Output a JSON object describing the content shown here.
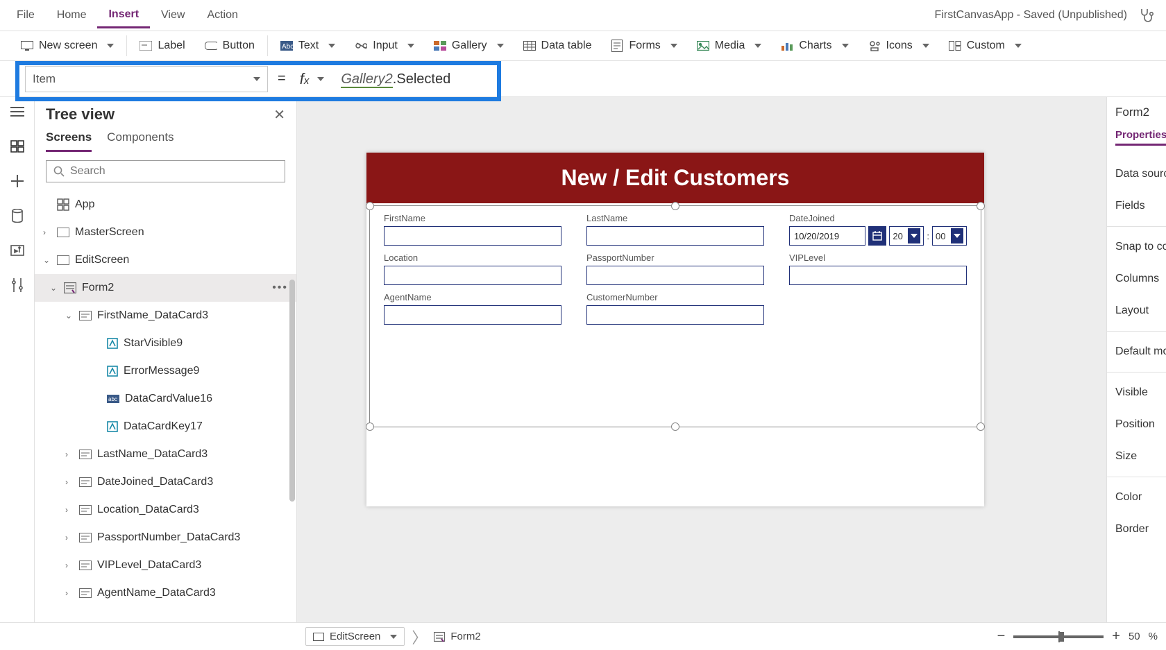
{
  "menu": {
    "items": [
      "File",
      "Home",
      "Insert",
      "View",
      "Action"
    ],
    "active": 2,
    "appTitle": "FirstCanvasApp - Saved (Unpublished)"
  },
  "ribbon": {
    "newScreen": "New screen",
    "label": "Label",
    "button": "Button",
    "text": "Text",
    "input": "Input",
    "gallery": "Gallery",
    "dataTable": "Data table",
    "forms": "Forms",
    "media": "Media",
    "charts": "Charts",
    "icons": "Icons",
    "custom": "Custom"
  },
  "formula": {
    "property": "Item",
    "gallRef": "Gallery2",
    "rest": ".Selected",
    "intelli": "Selected"
  },
  "tree": {
    "title": "Tree view",
    "tabs": [
      "Screens",
      "Components"
    ],
    "searchPlaceholder": "Search",
    "app": "App",
    "items": [
      {
        "name": "MasterScreen"
      },
      {
        "name": "EditScreen"
      }
    ],
    "form": "Form2",
    "card1": "FirstName_DataCard3",
    "children1": [
      "StarVisible9",
      "ErrorMessage9",
      "DataCardValue16",
      "DataCardKey17"
    ],
    "restCards": [
      "LastName_DataCard3",
      "DateJoined_DataCard3",
      "Location_DataCard3",
      "PassportNumber_DataCard3",
      "VIPLevel_DataCard3",
      "AgentName_DataCard3"
    ]
  },
  "canvas": {
    "header": "New / Edit Customers",
    "fields": {
      "firstName": "FirstName",
      "lastName": "LastName",
      "dateJoined": "DateJoined",
      "dateVal": "10/20/2019",
      "hour": "20",
      "min": "00",
      "location": "Location",
      "passport": "PassportNumber",
      "vip": "VIPLevel",
      "agent": "AgentName",
      "customerNo": "CustomerNumber"
    }
  },
  "properties": {
    "panelTitle": "Form2",
    "tab": "Properties",
    "rows": [
      "Data source",
      "Fields",
      "Snap to columns",
      "Columns",
      "Layout",
      "Default mode",
      "Visible",
      "Position",
      "Size",
      "Color",
      "Border"
    ]
  },
  "bottom": {
    "crumb1": "EditScreen",
    "crumb2": "Form2",
    "zoom": "50",
    "zoomPct": "%"
  }
}
